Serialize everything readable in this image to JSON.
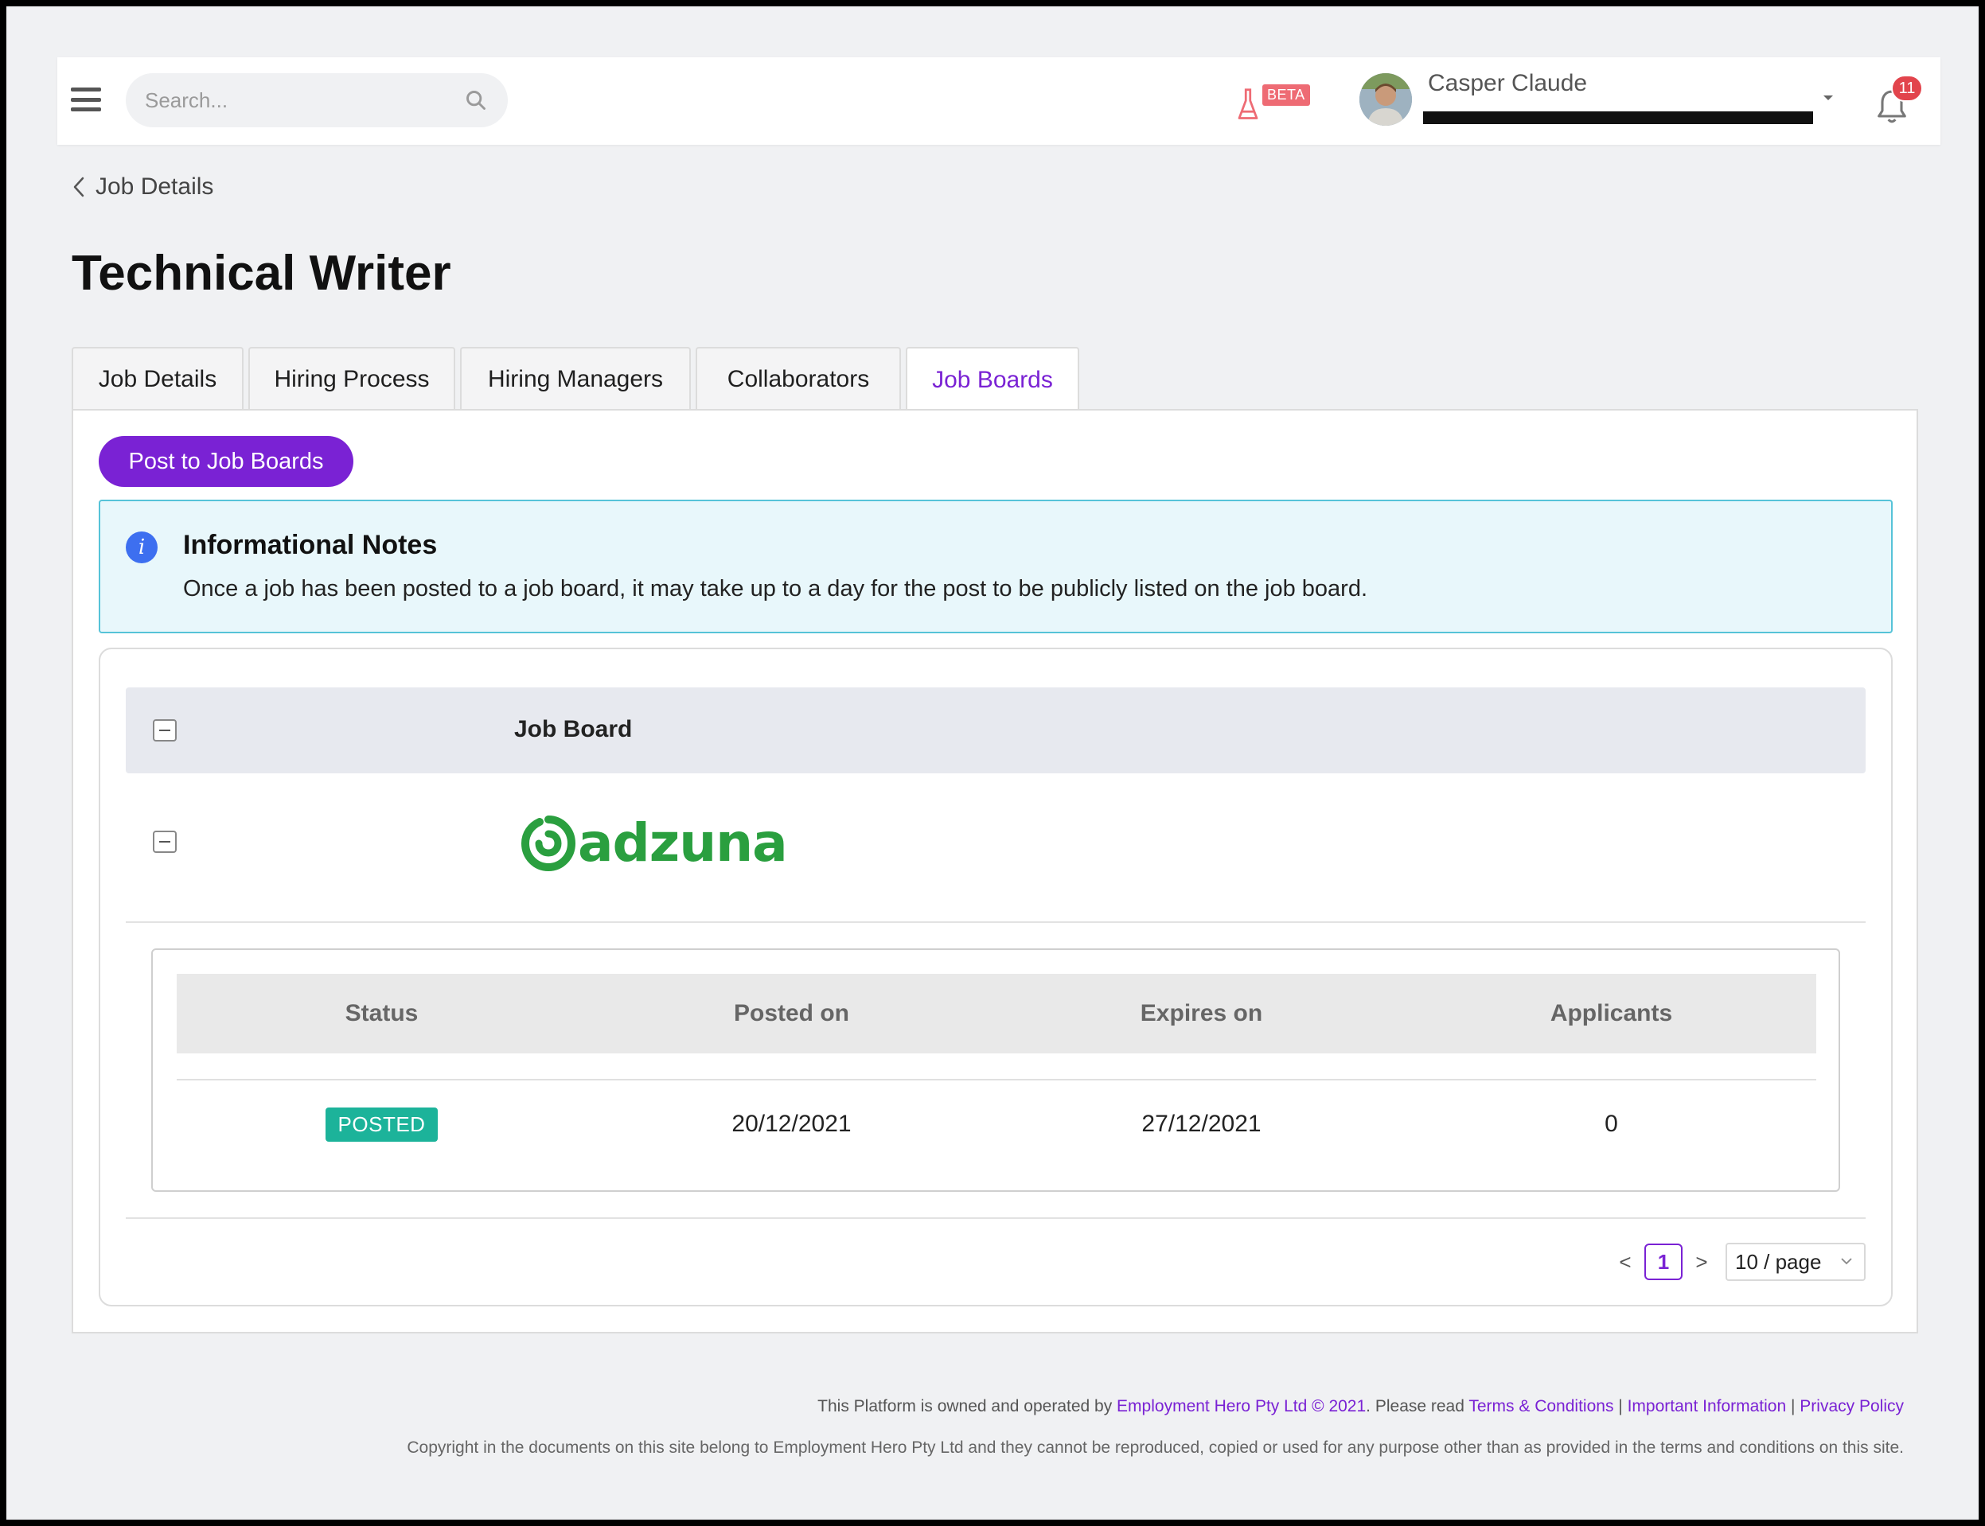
{
  "header": {
    "search_placeholder": "Search...",
    "beta_label": "BETA",
    "user_name": "Casper Claude",
    "notification_count": "11"
  },
  "breadcrumb": {
    "label": "Job Details"
  },
  "page": {
    "title": "Technical Writer"
  },
  "tabs": [
    {
      "label": "Job Details",
      "active": false
    },
    {
      "label": "Hiring Process",
      "active": false
    },
    {
      "label": "Hiring Managers",
      "active": false
    },
    {
      "label": "Collaborators",
      "active": false
    },
    {
      "label": "Job Boards",
      "active": true
    }
  ],
  "actions": {
    "post_label": "Post to Job Boards"
  },
  "info": {
    "title": "Informational Notes",
    "text": "Once a job has been posted to a job board, it may take up to a day for the post to be publicly listed on the job board."
  },
  "job_boards_table": {
    "header": "Job Board",
    "boards": [
      {
        "name": "adzuna",
        "columns": [
          "Status",
          "Posted on",
          "Expires on",
          "Applicants"
        ],
        "rows": [
          {
            "status": "POSTED",
            "posted_on": "20/12/2021",
            "expires_on": "27/12/2021",
            "applicants": "0"
          }
        ]
      }
    ]
  },
  "pagination": {
    "prev": "<",
    "current": "1",
    "next": ">",
    "page_size": "10 / page"
  },
  "footer": {
    "line1_prefix": "This Platform is owned and operated by ",
    "company_link": "Employment Hero Pty Ltd © 2021",
    "line1_middle": ". Please read ",
    "terms_link": "Terms & Conditions",
    "sep": " | ",
    "important_link": "Important Information",
    "privacy_link": "Privacy Policy",
    "copyright": "Copyright in the documents on this site belong to Employment Hero Pty Ltd and they cannot be reproduced, copied or used for any purpose other than as provided in the terms and conditions on this site."
  },
  "colors": {
    "accent": "#7a22d4",
    "status_posted": "#1cb39a",
    "info_border": "#56c3d8",
    "info_bg": "#e8f7fb",
    "brand_adzuna": "#2a9f3f",
    "notification": "#e2444c"
  },
  "icons": [
    "menu-icon",
    "search-icon",
    "flask-icon",
    "chevron-down-icon",
    "bell-icon",
    "back-chevron-icon",
    "info-icon",
    "collapse-icon"
  ]
}
